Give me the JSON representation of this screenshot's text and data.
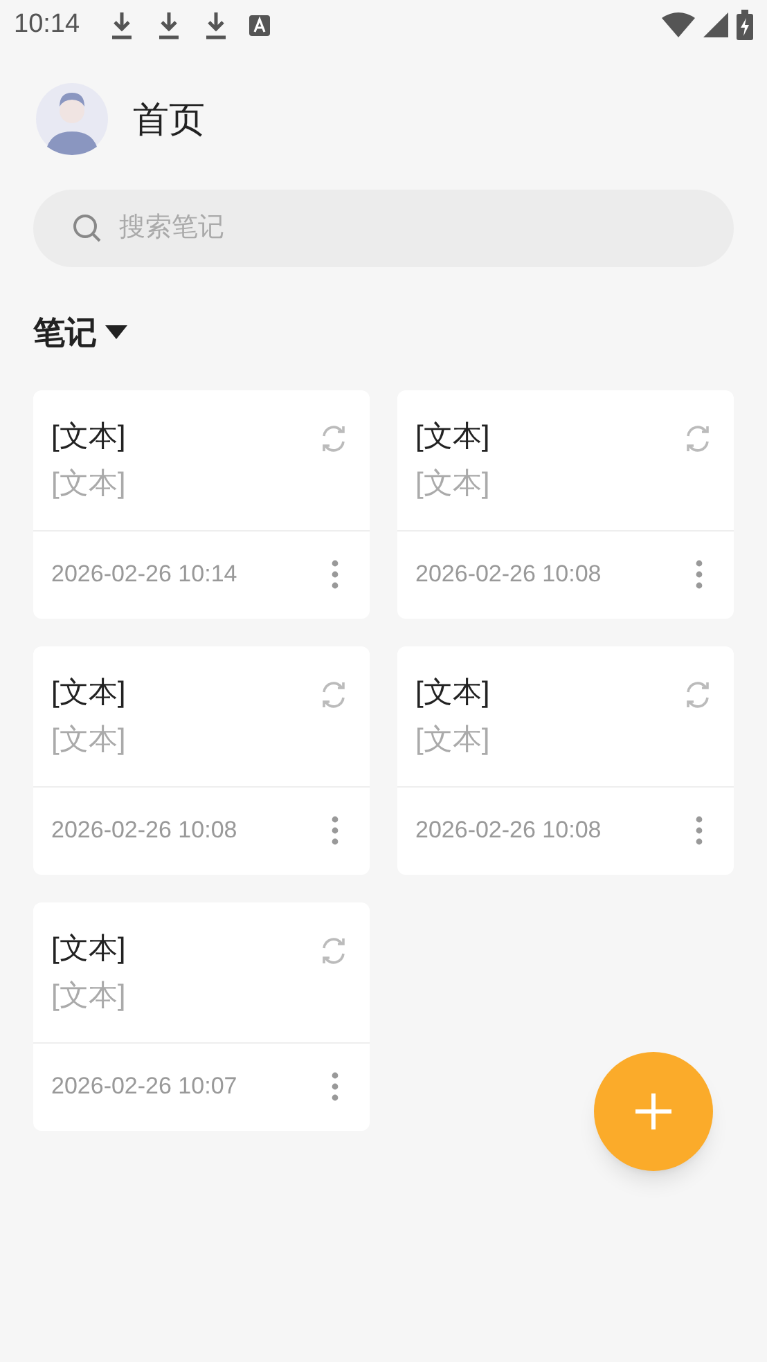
{
  "status_bar": {
    "time": "10:14"
  },
  "header": {
    "title": "首页"
  },
  "search": {
    "placeholder": "搜索笔记"
  },
  "section": {
    "title": "笔记"
  },
  "notes": [
    {
      "title": "[文本]",
      "preview": "[文本]",
      "date": "2026-02-26 10:14"
    },
    {
      "title": "[文本]",
      "preview": "[文本]",
      "date": "2026-02-26 10:08"
    },
    {
      "title": "[文本]",
      "preview": "[文本]",
      "date": "2026-02-26 10:08"
    },
    {
      "title": "[文本]",
      "preview": "[文本]",
      "date": "2026-02-26 10:08"
    },
    {
      "title": "[文本]",
      "preview": "[文本]",
      "date": "2026-02-26 10:07"
    }
  ]
}
